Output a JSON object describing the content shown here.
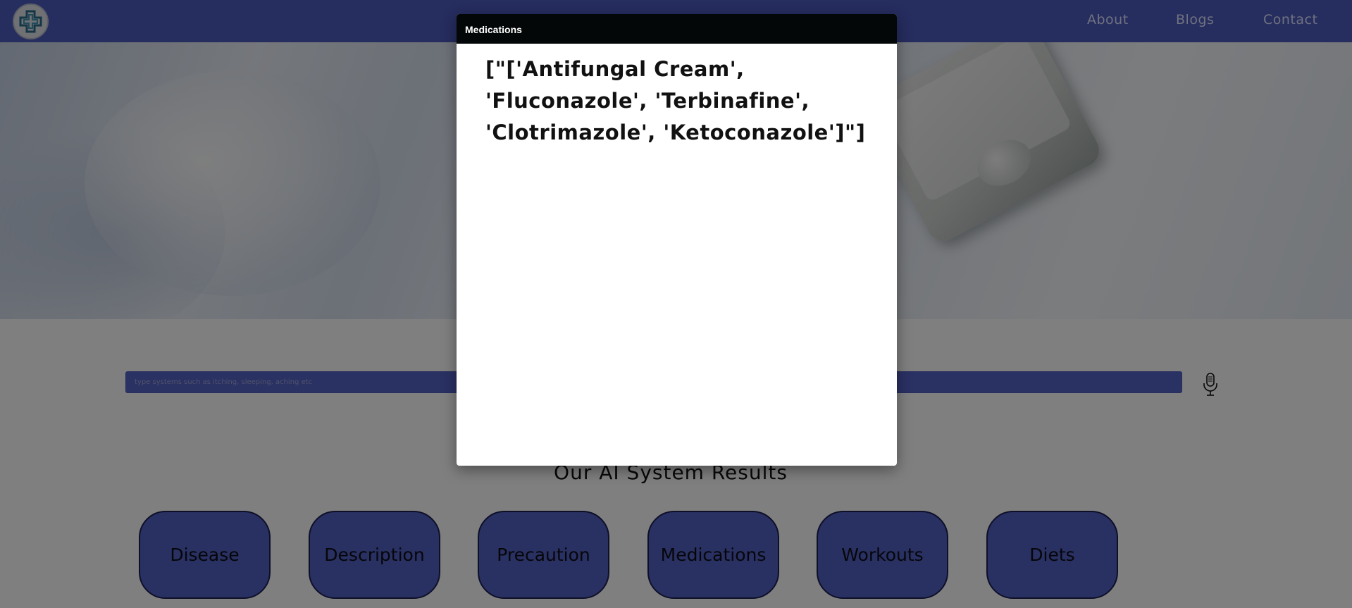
{
  "nav": {
    "links": [
      "About",
      "Blogs",
      "Contact"
    ]
  },
  "search": {
    "placeholder": "type systems such as itching, sleeping, aching etc"
  },
  "results": {
    "title": "Our AI System Results",
    "buttons": [
      "Disease",
      "Description",
      "Precaution",
      "Medications",
      "Workouts",
      "Diets"
    ]
  },
  "modal": {
    "title": "Medications",
    "body": "[\"['Antifungal Cream', 'Fluconazole', 'Terbinafine', 'Clotrimazole', 'Ketoconazole']\"]"
  },
  "colors": {
    "navbar": "#4c5bbf",
    "button": "#5261c4",
    "modal_header": "#040708"
  },
  "icons": {
    "logo": "medical-cross-logo",
    "mic": "microphone-icon"
  }
}
